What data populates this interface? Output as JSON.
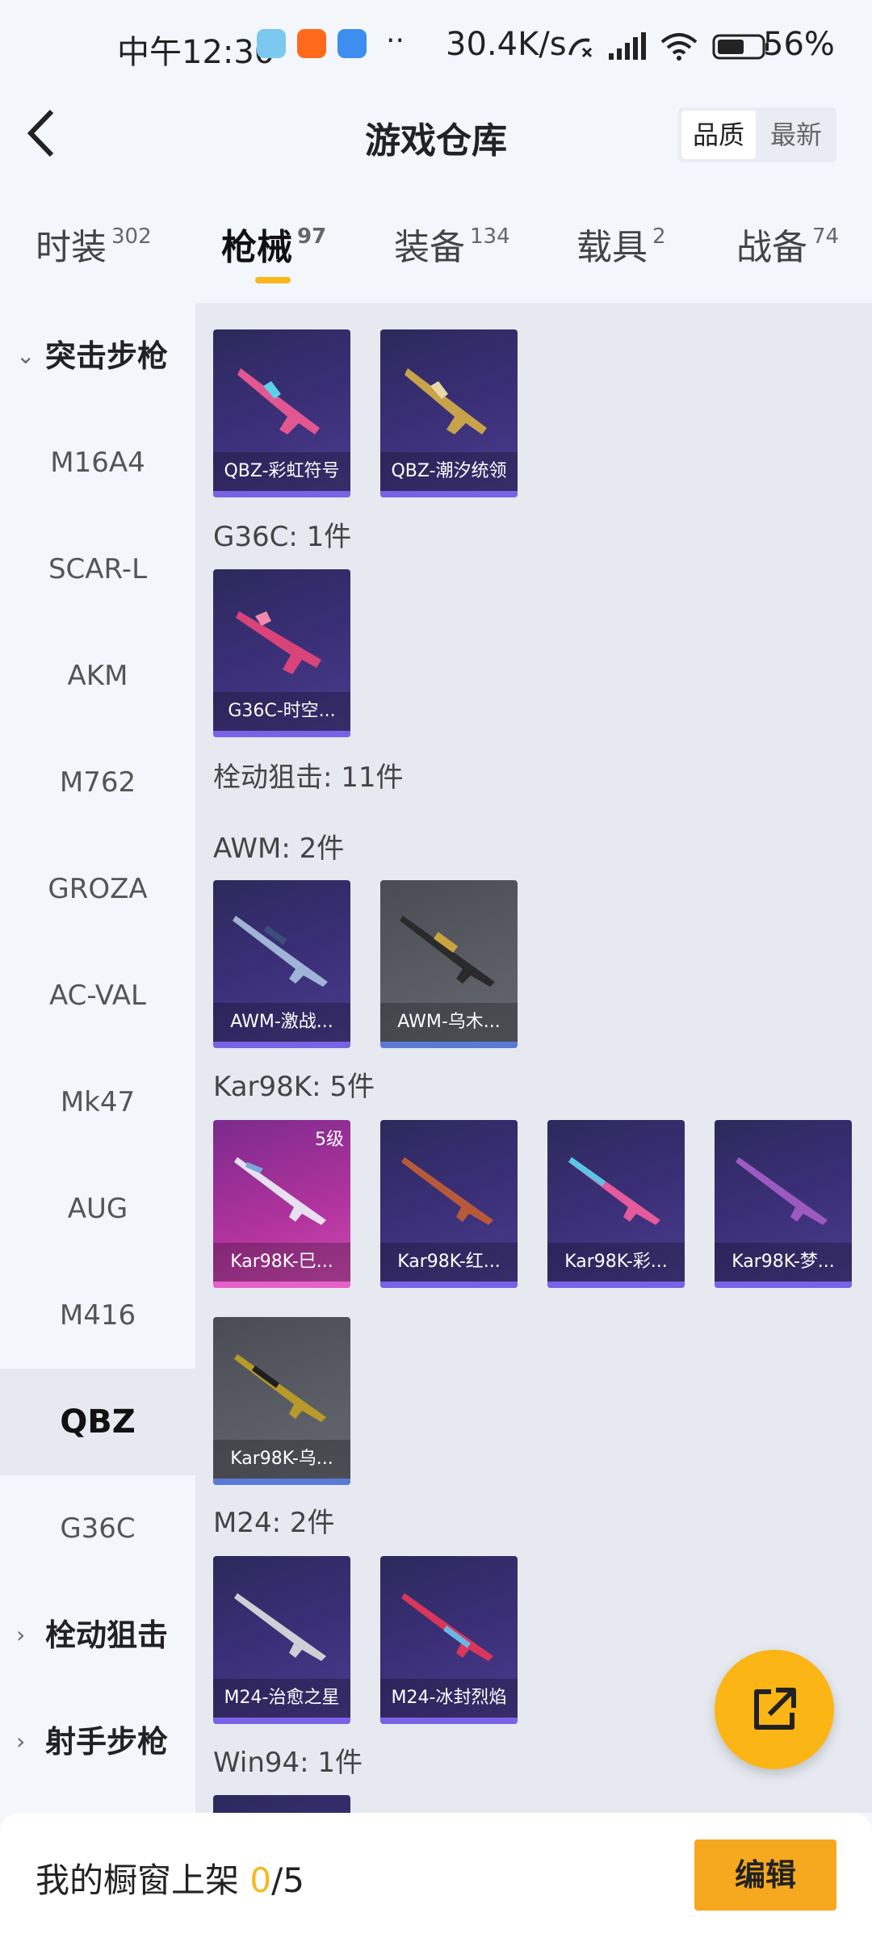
{
  "status_bar": {
    "time": "中午12:30",
    "dots": "··",
    "speed": "30.4K/s",
    "battery": "56%"
  },
  "header": {
    "title": "游戏仓库",
    "sort_options": [
      "品质",
      "最新"
    ]
  },
  "tabs": [
    {
      "label": "时装",
      "count": "302"
    },
    {
      "label": "枪械",
      "count": "97"
    },
    {
      "label": "装备",
      "count": "134"
    },
    {
      "label": "载具",
      "count": "2"
    },
    {
      "label": "战备",
      "count": "74"
    }
  ],
  "sidebar": {
    "items": [
      "突击步枪",
      "M16A4",
      "SCAR-L",
      "AKM",
      "M762",
      "GROZA",
      "AC-VAL",
      "Mk47",
      "AUG",
      "M416",
      "QBZ",
      "G36C",
      "栓动狙击",
      "射手步枪"
    ]
  },
  "content": {
    "qbz_cards": [
      "QBZ-彩虹符号",
      "QBZ-潮汐统领"
    ],
    "g36c_label": "G36C: 1件",
    "g36c_cards": [
      "G36C-时空..."
    ],
    "bolt_label": "栓动狙击: 11件",
    "awm_label": "AWM: 2件",
    "awm_cards": [
      "AWM-激战...",
      "AWM-乌木..."
    ],
    "kar_label": "Kar98K: 5件",
    "kar_cards": [
      "Kar98K-巳...",
      "Kar98K-红...",
      "Kar98K-彩...",
      "Kar98K-梦...",
      "Kar98K-乌..."
    ],
    "kar_level": "5级",
    "m24_label": "M24: 2件",
    "m24_cards": [
      "M24-治愈之星",
      "M24-冰封烈焰"
    ],
    "win94_label": "Win94: 1件"
  },
  "bottom": {
    "label": "我的橱窗上架 ",
    "current": "0",
    "total": "/5",
    "edit": "编辑"
  },
  "colors": {
    "accent": "#f7b71d",
    "card_purple": "#3b2f78",
    "card_grey": "#5c5e66",
    "card_pink": "#b3349e"
  }
}
